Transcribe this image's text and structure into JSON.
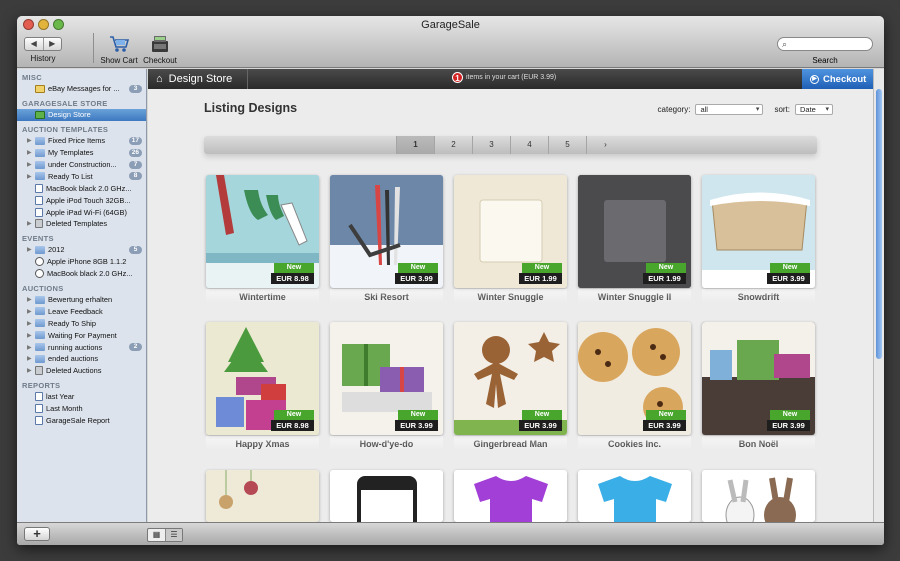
{
  "window": {
    "title": "GarageSale"
  },
  "toolbar": {
    "back_arrow": "◀",
    "forward_arrow": "▶",
    "history_label": "History",
    "show_cart_label": "Show Cart",
    "checkout_label": "Checkout",
    "search_label": "Search",
    "search_placeholder": ""
  },
  "sidebar": {
    "misc_header": "MISC",
    "ebay_messages": {
      "label": "eBay Messages for ...",
      "badge": "3"
    },
    "store_header": "GARAGESALE STORE",
    "design_store": "Design Store",
    "templates_header": "AUCTION TEMPLATES",
    "templates": [
      {
        "label": "Fixed Price Items",
        "badge": "17",
        "arrow": true
      },
      {
        "label": "My Templates",
        "badge": "26",
        "arrow": true
      },
      {
        "label": "under Construction...",
        "badge": "7",
        "arrow": true
      },
      {
        "label": "Ready To List",
        "badge": "8",
        "arrow": true
      },
      {
        "label": "MacBook black 2.0 GHz...",
        "badge": "",
        "arrow": false
      },
      {
        "label": "Apple iPod Touch 32GB...",
        "badge": "",
        "arrow": false
      },
      {
        "label": "Apple iPad Wi-Fi (64GB)",
        "badge": "",
        "arrow": false
      },
      {
        "label": "Deleted Templates",
        "badge": "",
        "arrow": true
      }
    ],
    "events_header": "EVENTS",
    "events": [
      {
        "label": "2012",
        "badge": "5"
      },
      {
        "label": "Apple iPhone 8GB  1.1.2",
        "badge": ""
      },
      {
        "label": "MacBook black 2.0 GHz...",
        "badge": ""
      }
    ],
    "auctions_header": "AUCTIONS",
    "auctions": [
      {
        "label": "Bewertung erhalten",
        "badge": ""
      },
      {
        "label": "Leave Feedback",
        "badge": ""
      },
      {
        "label": "Ready To Ship",
        "badge": ""
      },
      {
        "label": "Waiting For Payment",
        "badge": ""
      },
      {
        "label": "running auctions",
        "badge": "2"
      },
      {
        "label": "ended auctions",
        "badge": ""
      },
      {
        "label": "Deleted Auctions",
        "badge": ""
      }
    ],
    "reports_header": "REPORTS",
    "reports": [
      "last Year",
      "Last Month",
      "GarageSale Report"
    ]
  },
  "bottombar": {
    "add_label": "+",
    "grid_view": "▦",
    "list_view": "☰"
  },
  "store": {
    "breadcrumb": "Design Store",
    "cart_count": "1",
    "cart_text": "items in your cart (EUR 3.99)",
    "checkout_label": "Checkout",
    "heading": "Listing Designs",
    "category_label": "category:",
    "category_value": "all",
    "sort_label": "sort:",
    "sort_value": "Date",
    "pages": [
      "1",
      "2",
      "3",
      "4",
      "5",
      "›"
    ],
    "current_page": "1"
  },
  "designs": [
    {
      "name": "Wintertime",
      "badge": "New",
      "price": "EUR 8.98",
      "bg": "#9fd0d6"
    },
    {
      "name": "Ski Resort",
      "badge": "New",
      "price": "EUR 3.99",
      "bg": "#6d87a8"
    },
    {
      "name": "Winter Snuggle",
      "badge": "New",
      "price": "EUR 1.99",
      "bg": "#efe8d6"
    },
    {
      "name": "Winter Snuggle II",
      "badge": "New",
      "price": "EUR 1.99",
      "bg": "#4b4a4d"
    },
    {
      "name": "Snowdrift",
      "badge": "New",
      "price": "EUR 3.99",
      "bg": "#cde6ef"
    },
    {
      "name": "Happy Xmas",
      "badge": "New",
      "price": "EUR 8.98",
      "bg": "#ebe9d1"
    },
    {
      "name": "How-d'ye-do",
      "badge": "New",
      "price": "EUR 3.99",
      "bg": "#f4f2ea"
    },
    {
      "name": "Gingerbread Man",
      "badge": "New",
      "price": "EUR 3.99",
      "bg": "#f3efe6"
    },
    {
      "name": "Cookies Inc.",
      "badge": "New",
      "price": "EUR 3.99",
      "bg": "#f0ece2"
    },
    {
      "name": "Bon Noël",
      "badge": "New",
      "price": "EUR 3.99",
      "bg": "#4a3c36"
    }
  ],
  "colors": {
    "accent": "#3e78c0",
    "new_badge": "#49a62d",
    "cart_badge": "#d32222"
  }
}
